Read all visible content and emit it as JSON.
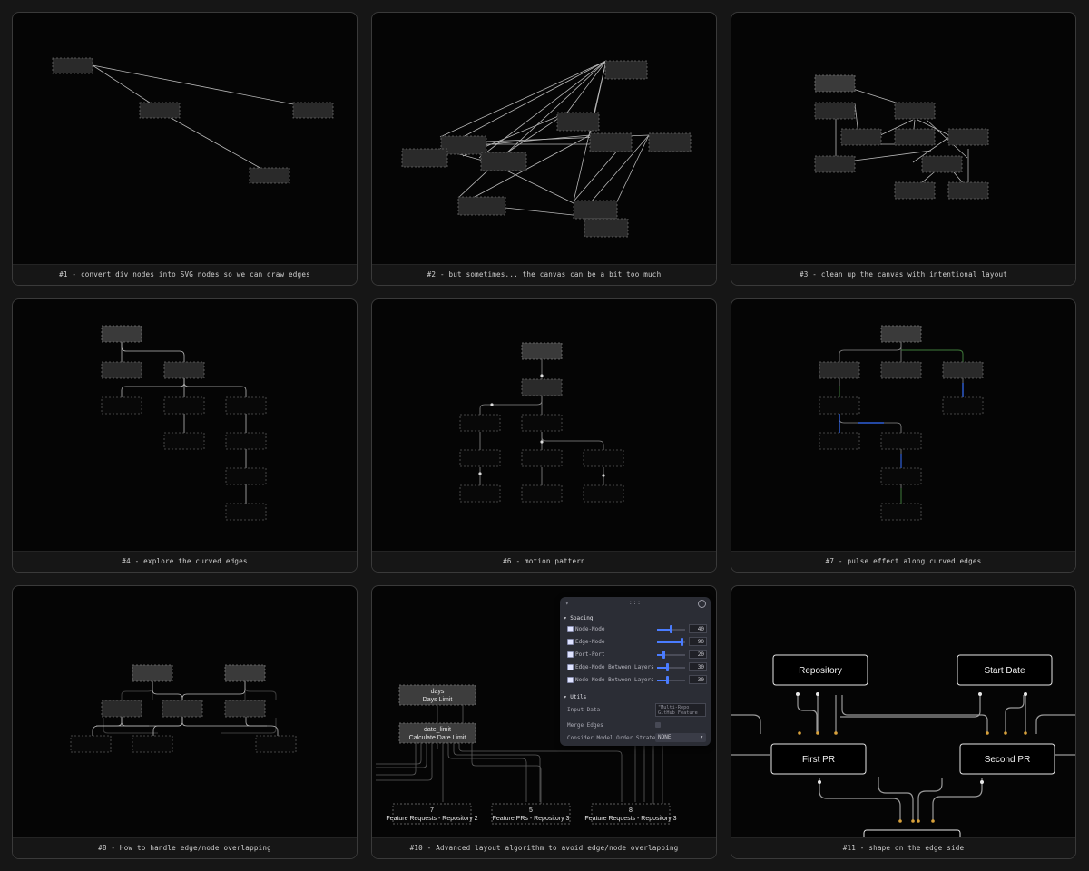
{
  "cards": [
    {
      "caption": "#1 - convert div nodes into SVG nodes so we can draw edges"
    },
    {
      "caption": "#2 - but sometimes... the canvas can be a bit too much"
    },
    {
      "caption": "#3 - clean up the canvas with intentional layout"
    },
    {
      "caption": "#4 - explore the curved edges"
    },
    {
      "caption": "#6 - motion pattern"
    },
    {
      "caption": "#7 - pulse effect along curved edges"
    },
    {
      "caption": "#8 - How to handle edge/node overlapping"
    },
    {
      "caption": "#10 - Advanced layout algorithm to avoid edge/node overlapping"
    },
    {
      "caption": "#11 - shape on the edge side"
    }
  ],
  "card10": {
    "nodes": [
      {
        "title": "days",
        "subtitle": "Days Limit"
      },
      {
        "title": "date_limit",
        "subtitle": "Calculate Date Limit"
      },
      {
        "title": "7",
        "subtitle": "Feature Requests - Repository 2"
      },
      {
        "title": "5",
        "subtitle": "Feature PRs - Repository 3"
      },
      {
        "title": "8",
        "subtitle": "Feature Requests - Repository 3"
      }
    ],
    "panel": {
      "grip": ":::",
      "spacing_title": "Spacing",
      "sliders": [
        {
          "label": "Node-Node",
          "value": "40",
          "level": 0.48
        },
        {
          "label": "Edge-Node",
          "value": "90",
          "level": 0.88
        },
        {
          "label": "Port-Port",
          "value": "20",
          "level": 0.22
        },
        {
          "label": "Edge-Node Between Layers",
          "value": "30",
          "level": 0.36
        },
        {
          "label": "Node-Node Between Layers",
          "value": "30",
          "level": 0.36
        }
      ],
      "utils_title": "Utils",
      "input_label": "Input Data",
      "input_value": "\"Multi-Repo GitHub Feature",
      "merge_label": "Merge Edges",
      "order_label": "Consider Model Order Strate…",
      "order_value": "NONE"
    }
  },
  "card11": {
    "boxes": [
      {
        "label": "Repository"
      },
      {
        "label": "Start Date"
      },
      {
        "label": "First PR"
      },
      {
        "label": "Second PR"
      }
    ],
    "colors": {
      "port": "#d9a23b",
      "dot": "#e8e8e8"
    }
  },
  "colors": {
    "pulse_green": "#3f7a3a",
    "pulse_blue": "#2f5fd8",
    "slider_blue": "#4a7cff"
  }
}
